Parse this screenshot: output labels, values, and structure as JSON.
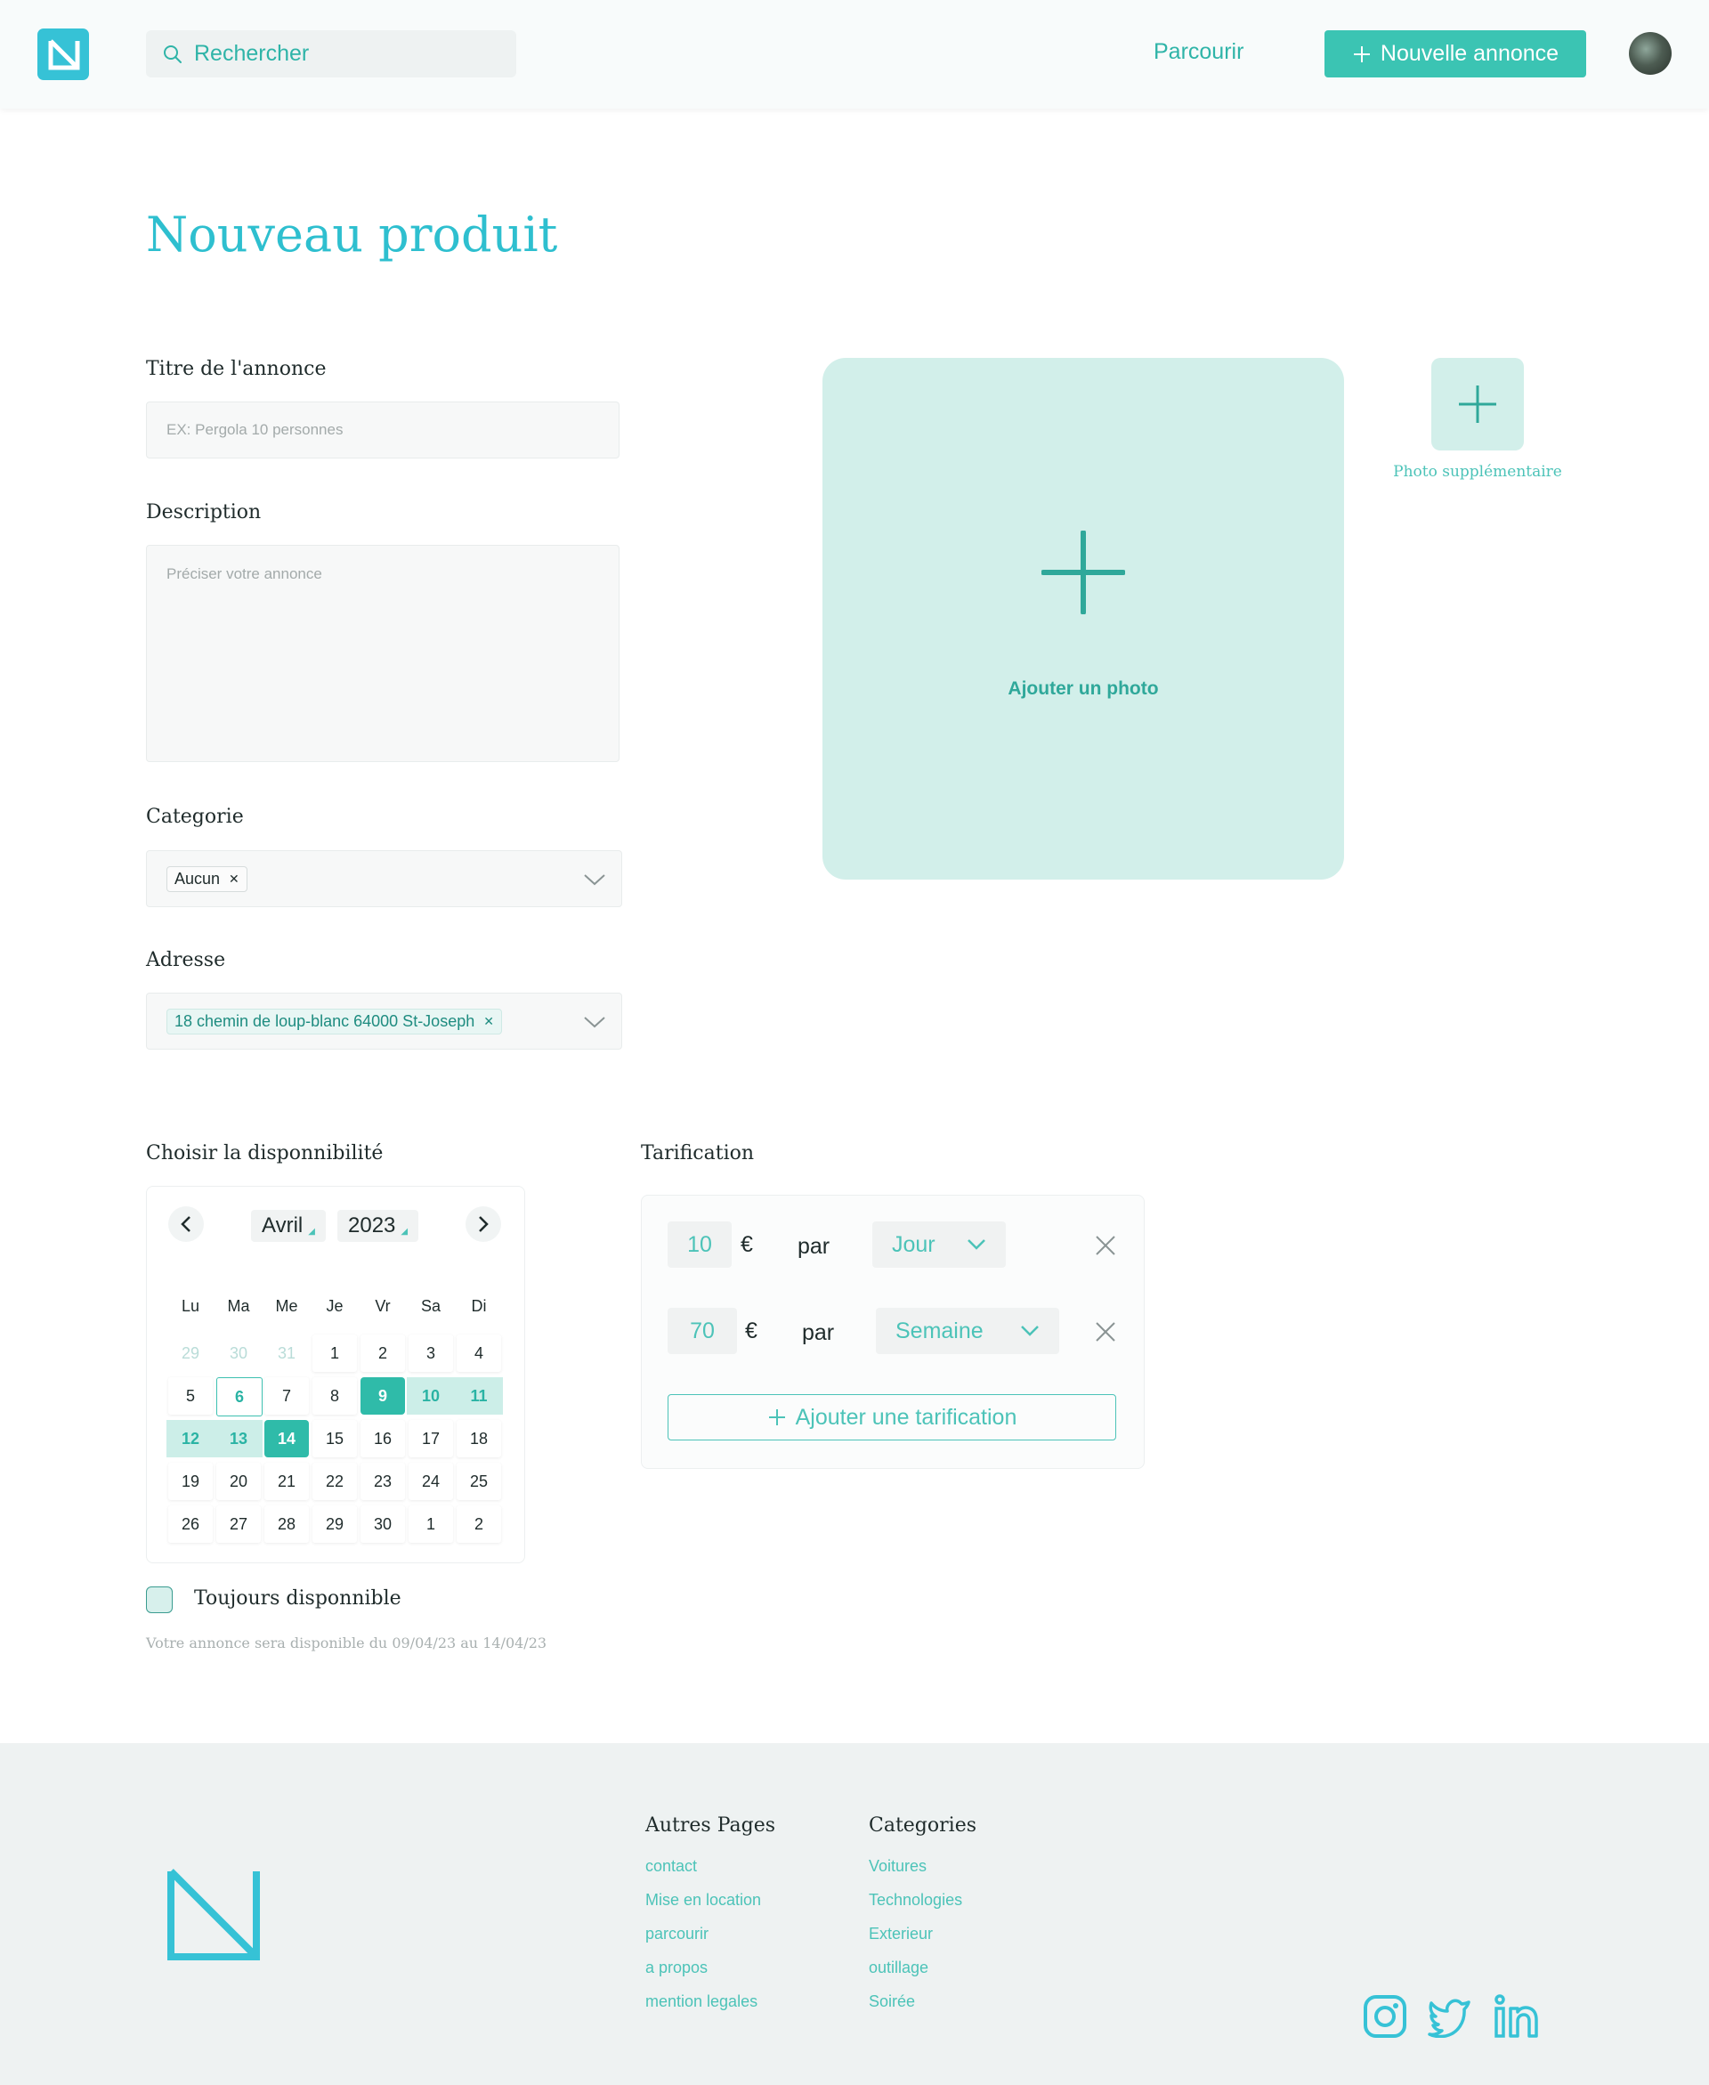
{
  "header": {
    "search_placeholder": "Rechercher",
    "nav_link": "Parcourir",
    "new_button": "Nouvelle annonce"
  },
  "page": {
    "title": "Nouveau produit"
  },
  "form": {
    "title_label": "Titre de l'annonce",
    "title_placeholder": "EX: Pergola 10 personnes",
    "description_label": "Description",
    "description_placeholder": "Préciser votre annonce",
    "category_label": "Categorie",
    "category_chip": "Aucun",
    "address_label": "Adresse",
    "address_chip": "18 chemin de loup-blanc 64000 St-Joseph"
  },
  "photos": {
    "add_photo": "Ajouter un photo",
    "extra_photo": "Photo supplémentaire"
  },
  "availability": {
    "label": "Choisir la disponnibilité",
    "month": "Avril",
    "year": "2023",
    "weekdays": [
      "Lu",
      "Ma",
      "Me",
      "Je",
      "Vr",
      "Sa",
      "Di"
    ],
    "days": [
      "29",
      "30",
      "31",
      "1",
      "2",
      "3",
      "4",
      "5",
      "6",
      "7",
      "8",
      "9",
      "10",
      "11",
      "12",
      "13",
      "14",
      "15",
      "16",
      "17",
      "18",
      "19",
      "20",
      "21",
      "22",
      "23",
      "24",
      "25",
      "26",
      "27",
      "28",
      "29",
      "30",
      "1",
      "2"
    ],
    "always_label": "Toujours disponnible",
    "note": "Votre annonce sera disponible du 09/04/23 au 14/04/23"
  },
  "pricing": {
    "label": "Tarification",
    "rows": [
      {
        "amount": "10",
        "currency": "€",
        "per": "par",
        "unit": "Jour"
      },
      {
        "amount": "70",
        "currency": "€",
        "per": "par",
        "unit": "Semaine"
      }
    ],
    "add_label": "Ajouter une tarification"
  },
  "footer": {
    "pages_heading": "Autres Pages",
    "pages": [
      "contact",
      "Mise en location",
      "parcourir",
      "a propos",
      "mention legales"
    ],
    "categories_heading": "Categories",
    "categories": [
      "Voitures",
      "Technologies",
      "Exterieur",
      "outillage",
      "Soirée"
    ]
  },
  "colors": {
    "accent": "#3bc4b3",
    "title": "#2ebfcf",
    "photo_bg": "#d2efea"
  }
}
